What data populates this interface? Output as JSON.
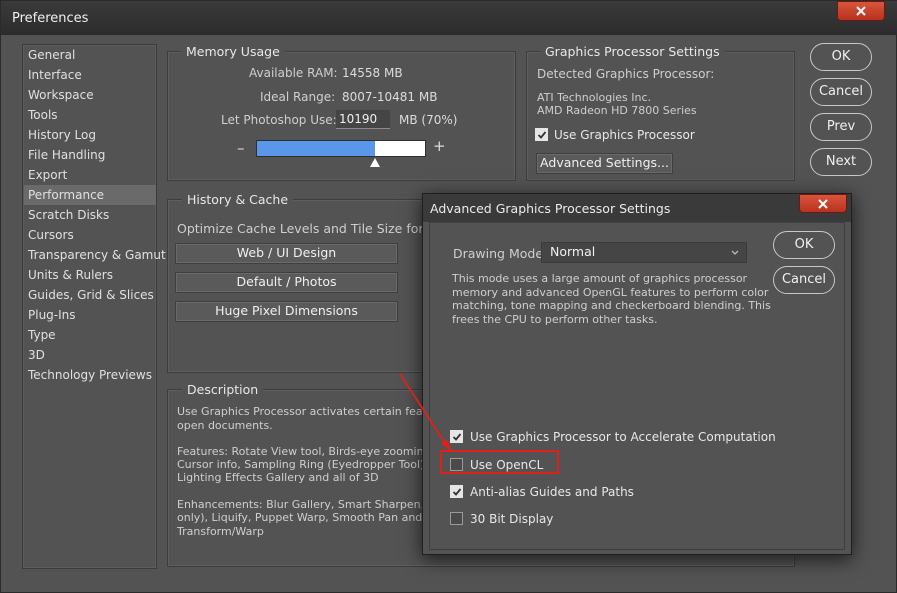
{
  "window": {
    "title": "Preferences"
  },
  "sidebar": {
    "items": [
      {
        "label": "General"
      },
      {
        "label": "Interface"
      },
      {
        "label": "Workspace"
      },
      {
        "label": "Tools"
      },
      {
        "label": "History Log"
      },
      {
        "label": "File Handling"
      },
      {
        "label": "Export"
      },
      {
        "label": "Performance",
        "selected": true
      },
      {
        "label": "Scratch Disks"
      },
      {
        "label": "Cursors"
      },
      {
        "label": "Transparency & Gamut"
      },
      {
        "label": "Units & Rulers"
      },
      {
        "label": "Guides, Grid & Slices"
      },
      {
        "label": "Plug-Ins"
      },
      {
        "label": "Type"
      },
      {
        "label": "3D"
      },
      {
        "label": "Technology Previews"
      }
    ]
  },
  "memory": {
    "title": "Memory Usage",
    "available_label": "Available RAM:",
    "available_value": "14558 MB",
    "ideal_label": "Ideal Range:",
    "ideal_value": "8007-10481 MB",
    "let_label": "Let Photoshop Use:",
    "let_value": "10190",
    "let_unit": "MB (70%)",
    "minus": "–",
    "plus": "+",
    "slider_fraction": 0.7
  },
  "gpu": {
    "title": "Graphics Processor Settings",
    "detected_label": "Detected Graphics Processor:",
    "vendor": "ATI Technologies Inc.",
    "model": "AMD Radeon HD 7800 Series",
    "use_gpu_label": "Use Graphics Processor",
    "use_gpu_checked": true,
    "advanced_button": "Advanced Settings..."
  },
  "history_cache": {
    "title": "History & Cache",
    "optimize_label": "Optimize Cache Levels and Tile Size for:",
    "buttons": [
      "Web / UI Design",
      "Default / Photos",
      "Huge Pixel Dimensions"
    ]
  },
  "description": {
    "title": "Description",
    "p1": "Use Graphics Processor activates certain feature",
    "p1b": "open documents.",
    "p2a": "Features: Rotate View tool, Birds-eye zooming,",
    "p2b": "Cursor info, Sampling Ring (Eyedropper Tool), O",
    "p2c": "Lighting Effects Gallery and all of 3D",
    "p3a": "Enhancements: Blur Gallery, Smart Sharpen, Sele",
    "p3b": "only), Liquify, Puppet Warp, Smooth Pan and Zoo",
    "p3c": "Transform/Warp"
  },
  "actions": {
    "ok": "OK",
    "cancel": "Cancel",
    "prev": "Prev",
    "next": "Next"
  },
  "advanced": {
    "title": "Advanced Graphics Processor Settings",
    "drawing_mode_label": "Drawing Mode:",
    "drawing_mode_value": "Normal",
    "mode_description": [
      "This mode uses a large amount of graphics processor",
      "memory and advanced OpenGL features to perform color",
      "matching, tone mapping and checkerboard blending.  This",
      "frees the CPU to perform other tasks."
    ],
    "ok": "OK",
    "cancel": "Cancel",
    "options": [
      {
        "label": "Use Graphics Processor to Accelerate Computation",
        "checked": true
      },
      {
        "label": "Use OpenCL",
        "checked": false
      },
      {
        "label": "Anti-alias Guides and Paths",
        "checked": true
      },
      {
        "label": "30 Bit Display",
        "checked": false
      }
    ]
  },
  "colors": {
    "annotation": "#e0201a",
    "slider_fill": "#5b97e8",
    "close_button": "#c7402a"
  },
  "icons": [
    "close-icon",
    "checkmark-icon",
    "chevron-down-icon",
    "annotation-arrow"
  ]
}
